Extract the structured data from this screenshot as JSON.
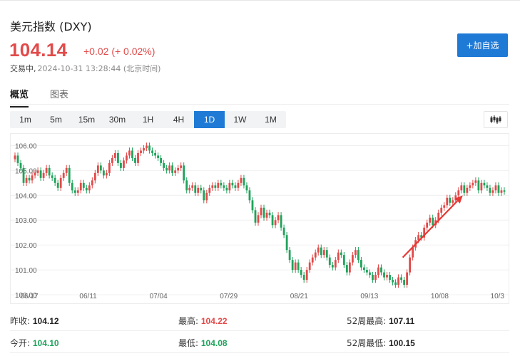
{
  "header": {
    "title": "美元指数 (DXY)",
    "price": "104.14",
    "change": "+0.02 (+ 0.02%)",
    "status": "交易中,",
    "timestamp": "2024-10-31 13:28:44 (北京时间)",
    "follow_button": "+加自选"
  },
  "tabs": [
    {
      "label": "概览",
      "active": true
    },
    {
      "label": "图表",
      "active": false
    }
  ],
  "periods": [
    {
      "label": "1m",
      "active": false
    },
    {
      "label": "5m",
      "active": false
    },
    {
      "label": "15m",
      "active": false
    },
    {
      "label": "30m",
      "active": false
    },
    {
      "label": "1H",
      "active": false
    },
    {
      "label": "4H",
      "active": false
    },
    {
      "label": "1D",
      "active": true
    },
    {
      "label": "1W",
      "active": false
    },
    {
      "label": "1M",
      "active": false
    }
  ],
  "colors": {
    "up": "#e24a4a",
    "down": "#1fa35b",
    "accent": "#1f7ad6",
    "arrow": "#e53935"
  },
  "chart_data": {
    "type": "candlestick",
    "ylim": [
      100.0,
      106.3
    ],
    "yticks": [
      "106.00",
      "105.00",
      "104.00",
      "103.00",
      "102.00",
      "101.00",
      "100.00"
    ],
    "x_labels": [
      "06/17",
      "06/11",
      "07/04",
      "07/29",
      "08/21",
      "09/13",
      "10/08",
      "10/3"
    ],
    "close": [
      105.6,
      105.3,
      105.1,
      104.5,
      104.7,
      104.6,
      104.8,
      104.9,
      105.0,
      104.7,
      104.9,
      105.1,
      104.8,
      104.7,
      104.5,
      104.3,
      104.7,
      104.9,
      105.1,
      104.5,
      104.2,
      104.1,
      104.2,
      104.5,
      104.3,
      104.2,
      104.4,
      104.6,
      104.9,
      105.2,
      105.0,
      104.8,
      104.9,
      105.3,
      105.5,
      105.7,
      105.3,
      105.1,
      105.4,
      105.6,
      105.8,
      105.5,
      105.3,
      105.7,
      105.8,
      105.9,
      106.0,
      105.8,
      105.7,
      105.6,
      105.5,
      105.3,
      105.1,
      105.0,
      105.2,
      104.9,
      105.0,
      105.1,
      105.2,
      104.6,
      104.2,
      104.3,
      104.4,
      104.1,
      104.3,
      104.2,
      103.8,
      104.1,
      104.3,
      104.4,
      104.3,
      104.5,
      104.4,
      104.3,
      104.2,
      104.5,
      104.4,
      104.3,
      104.5,
      104.7,
      104.4,
      104.2,
      103.8,
      103.4,
      102.9,
      103.2,
      103.5,
      103.1,
      103.3,
      103.2,
      102.8,
      103.0,
      103.2,
      102.7,
      102.4,
      101.8,
      101.4,
      101.0,
      101.3,
      101.0,
      100.8,
      100.6,
      101.0,
      101.3,
      101.5,
      101.7,
      101.9,
      101.6,
      101.8,
      101.5,
      101.2,
      101.1,
      101.4,
      101.7,
      101.6,
      101.2,
      100.9,
      101.3,
      101.6,
      101.8,
      101.4,
      101.1,
      101.0,
      100.9,
      100.8,
      100.6,
      100.8,
      101.1,
      100.9,
      100.7,
      100.8,
      100.6,
      100.5,
      100.4,
      100.7,
      100.6,
      100.4,
      100.9,
      101.5,
      101.9,
      102.2,
      102.4,
      102.3,
      102.7,
      102.9,
      103.1,
      102.8,
      103.0,
      103.3,
      103.5,
      103.6,
      103.9,
      103.7,
      103.8,
      104.0,
      104.2,
      104.4,
      104.1,
      104.3,
      104.4,
      104.5,
      104.6,
      104.2,
      104.5,
      104.4,
      104.3,
      104.1,
      104.2,
      104.4,
      104.1,
      104.2,
      104.14
    ],
    "arrow_from": {
      "x": 136,
      "y": 101.5
    },
    "arrow_to": {
      "x": 157,
      "y": 104.0
    }
  },
  "stats": {
    "row1": [
      {
        "label": "昨收:",
        "value": "104.12",
        "color": "dark"
      },
      {
        "label": "最高:",
        "value": "104.22",
        "color": "red"
      },
      {
        "label": "52周最高:",
        "value": "107.11",
        "color": "dark"
      }
    ],
    "row2": [
      {
        "label": "今开:",
        "value": "104.10",
        "color": "green"
      },
      {
        "label": "最低:",
        "value": "104.08",
        "color": "green"
      },
      {
        "label": "52周最低:",
        "value": "100.15",
        "color": "dark"
      }
    ]
  }
}
